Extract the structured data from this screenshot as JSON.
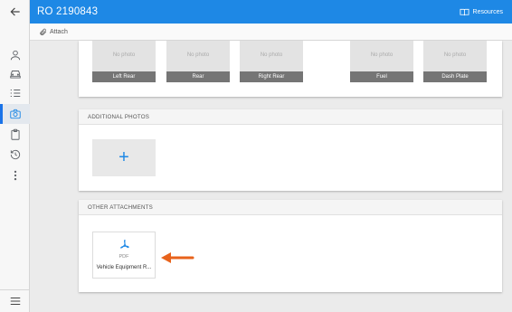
{
  "header": {
    "title": "RO 2190843",
    "resources_label": "Resources"
  },
  "toolbar": {
    "attach_label": "Attach"
  },
  "rail": {
    "items": [
      "back-arrow-icon",
      "person-icon",
      "car-icon",
      "checklist-icon",
      "camera-icon",
      "clipboard-icon",
      "history-icon",
      "more-vert-icon"
    ],
    "active": "camera-icon",
    "bottom": "menu-icon"
  },
  "photos": {
    "no_photo_text": "No photo",
    "slots": [
      {
        "label": "Left Rear"
      },
      {
        "label": "Rear"
      },
      {
        "label": "Right Rear"
      },
      {
        "label": "Fuel"
      },
      {
        "label": "Dash Plate"
      }
    ]
  },
  "additional_photos": {
    "title": "ADDITIONAL PHOTOS",
    "add_symbol": "+"
  },
  "other_attachments": {
    "title": "OTHER ATTACHMENTS",
    "items": [
      {
        "type": "PDF",
        "name": "Vehicle Equipment R..."
      }
    ]
  },
  "colors": {
    "header": "#1e88e5",
    "accent": "#1e88e5",
    "arrow": "#e8631c",
    "label_bar": "#757575"
  }
}
